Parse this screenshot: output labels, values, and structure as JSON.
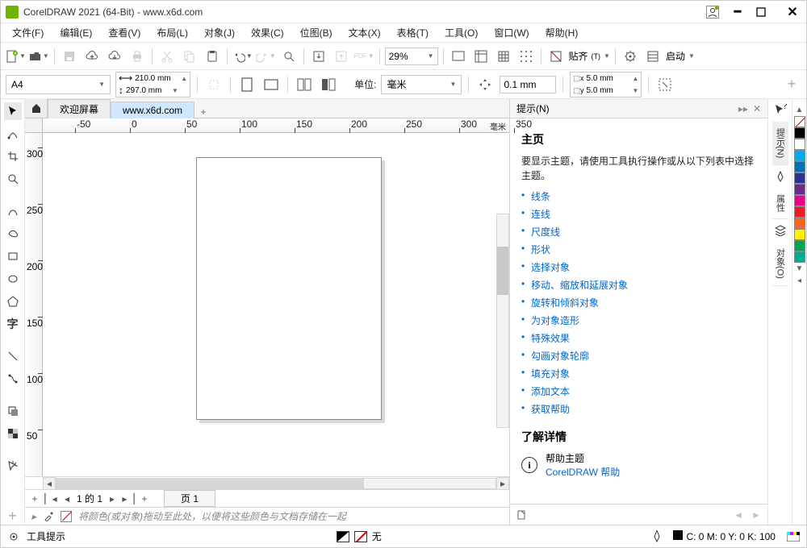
{
  "title": "CorelDRAW 2021 (64-Bit) - www.x6d.com",
  "menu": [
    "文件(F)",
    "编辑(E)",
    "查看(V)",
    "布局(L)",
    "对象(J)",
    "效果(C)",
    "位图(B)",
    "文本(X)",
    "表格(T)",
    "工具(O)",
    "窗口(W)",
    "帮助(H)"
  ],
  "toolbar": {
    "zoom": "29%",
    "snap_label": "贴齐",
    "start_label": "启动"
  },
  "propbar": {
    "page_size_display": "A4",
    "width_label": "210.0 mm",
    "height_label": "297.0 mm",
    "units_label": "单位:",
    "units_value": "毫米",
    "nudge_value": "0.1 mm",
    "dup_x": "5.0 mm",
    "dup_y": "5.0 mm"
  },
  "tabs": {
    "welcome": "欢迎屏幕",
    "active_doc": "www.x6d.com"
  },
  "hints": {
    "panel_title": "提示(N)",
    "h_main": "主页",
    "intro": "要显示主题，请使用工具执行操作或从以下列表中选择主题。",
    "topics": [
      "线条",
      "连线",
      "尺度线",
      "形状",
      "选择对象",
      "移动、缩放和延展对象",
      "旋转和倾斜对象",
      "为对象造形",
      "特殊效果",
      "勾画对象轮廓",
      "填充对象",
      "添加文本",
      "获取帮助"
    ],
    "learn_more": "了解详情",
    "help_topics": "帮助主题",
    "help_link": "CorelDRAW 帮助"
  },
  "right_tabs": [
    "提示(N)",
    "属性",
    "对象(O)"
  ],
  "ruler_unit": "毫米",
  "ruler_ticks": [
    -50,
    0,
    50,
    100,
    150,
    200,
    250,
    300,
    350
  ],
  "ruler_v": [
    300,
    250,
    200,
    150,
    100,
    50
  ],
  "page_nav": {
    "counter": "1 的 1",
    "page_label": "页 1"
  },
  "tray_hint": "将颜色(或对象)拖动至此处，以便将这些颜色与文档存储在一起",
  "status": {
    "tooltip_label": "工具提示",
    "none_label": "无",
    "cmyk": "C: 0 M: 0 Y: 0 K: 100"
  },
  "palette": [
    "#000000",
    "#FFFFFF",
    "#00AEEF",
    "#0072BC",
    "#2E3192",
    "#662D91",
    "#EC008C",
    "#ED1C24",
    "#F26522",
    "#FFF200",
    "#00A651",
    "#00A99D"
  ]
}
